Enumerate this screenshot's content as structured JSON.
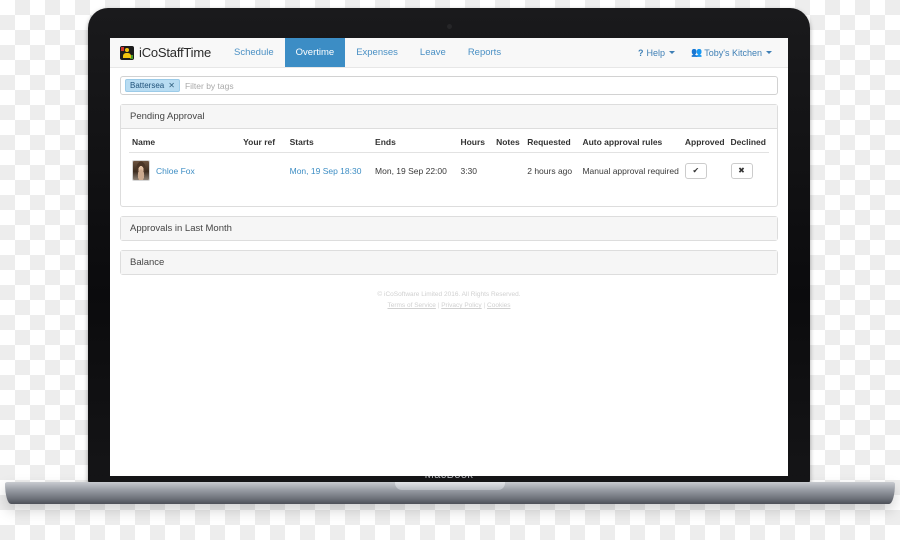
{
  "device": {
    "brand_label": "MacBook"
  },
  "app": {
    "brand_name": "iCoStaffTime",
    "nav_items": [
      {
        "label": "Schedule",
        "active": false
      },
      {
        "label": "Overtime",
        "active": true
      },
      {
        "label": "Expenses",
        "active": false
      },
      {
        "label": "Leave",
        "active": false
      },
      {
        "label": "Reports",
        "active": false
      }
    ],
    "help_label": "Help",
    "account_label": "Toby's Kitchen",
    "accent_color": "#3c8dc5",
    "link_color": "#3e8ec4"
  },
  "filter": {
    "tag_label": "Battersea",
    "tag_remove": "✕",
    "placeholder": "Filter by tags",
    "value": ""
  },
  "panels": [
    {
      "title": "Pending Approval"
    },
    {
      "title": "Approvals in Last Month"
    },
    {
      "title": "Balance"
    }
  ],
  "table": {
    "columns": [
      "Name",
      "Your ref",
      "Starts",
      "Ends",
      "Hours",
      "Notes",
      "Requested",
      "Auto approval rules",
      "Approved",
      "Declined"
    ],
    "rows": [
      {
        "name": "Chloe Fox",
        "your_ref": "",
        "starts": "Mon, 19 Sep 18:30",
        "ends": "Mon, 19 Sep 22:00",
        "hours": "3:30",
        "notes": "",
        "requested": "2 hours ago",
        "auto_approval_rules": "Manual approval required",
        "approve_glyph": "✔",
        "decline_glyph": "✖"
      }
    ]
  },
  "footer": {
    "copyright": "© iCoSoftware Limited 2016. All Rights Reserved.",
    "links": [
      "Terms of Service",
      "Privacy Policy",
      "Cookies"
    ],
    "separator": "|"
  }
}
